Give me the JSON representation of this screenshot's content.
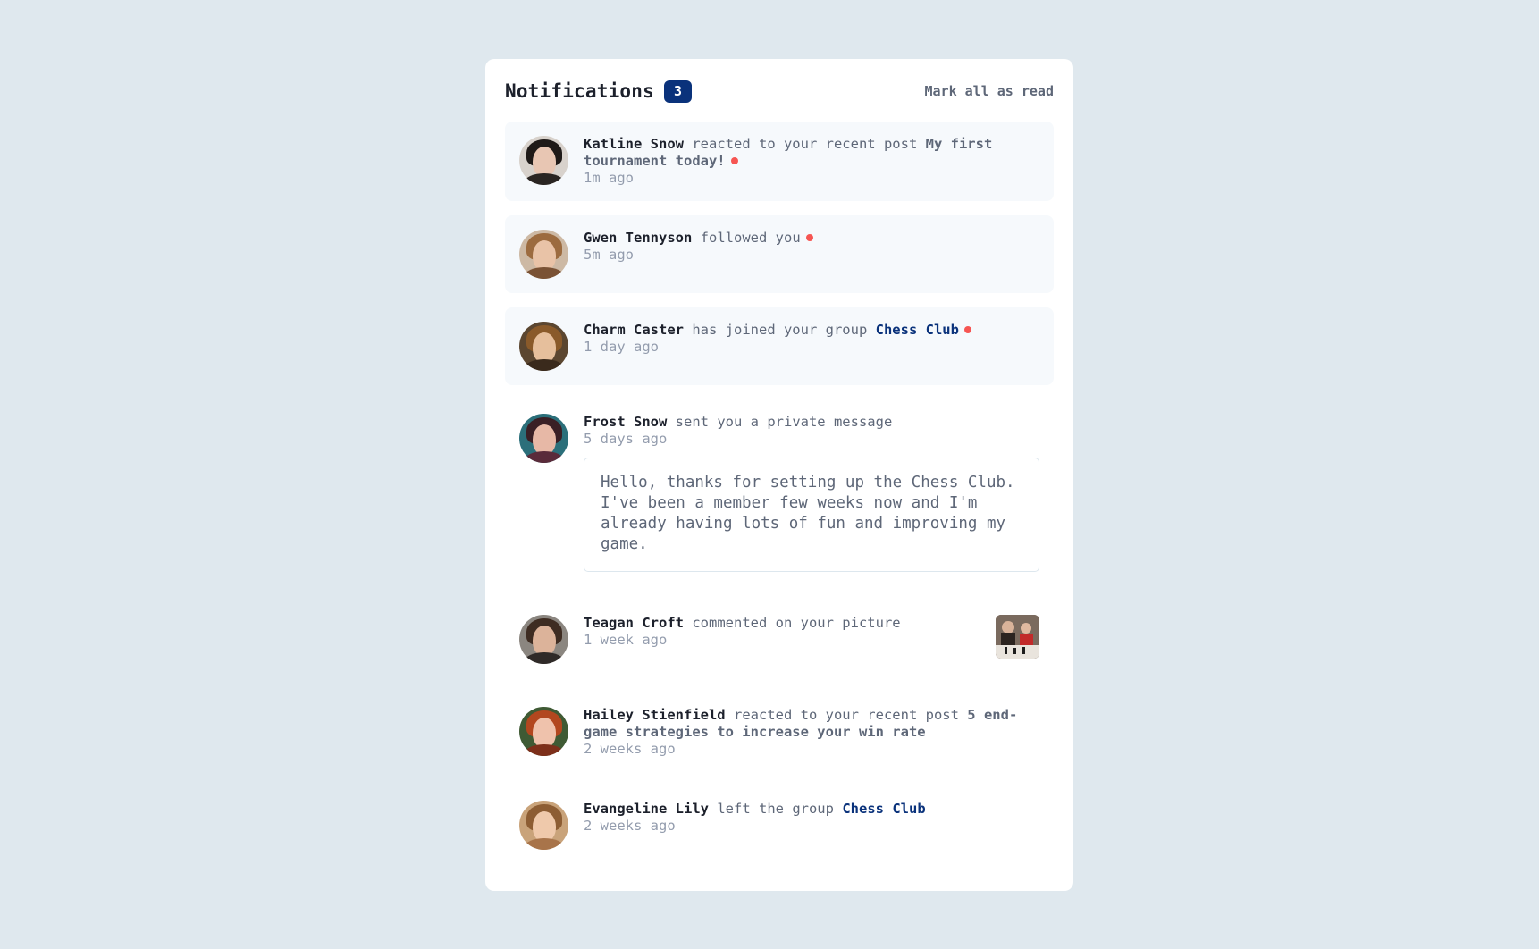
{
  "header": {
    "title": "Notifications",
    "unread_count": "3",
    "mark_all_label": "Mark all as read"
  },
  "notifications": [
    {
      "name": "Katline Snow",
      "action": "reacted to your recent post",
      "post": "My first tournament today!",
      "time": "1m ago",
      "unread": true,
      "avatar_colors": {
        "bg": "#d8d2cc",
        "hair": "#1f1a18",
        "face": "#e8c6b3",
        "body": "#2a2522"
      }
    },
    {
      "name": "Gwen Tennyson",
      "action": "followed you",
      "time": "5m ago",
      "unread": true,
      "avatar_colors": {
        "bg": "#cdb9a4",
        "hair": "#9c6b3f",
        "face": "#e9c3a7",
        "body": "#7a5234"
      }
    },
    {
      "name": "Charm Caster",
      "action": "has joined your group",
      "group": "Chess Club",
      "time": "1 day ago",
      "unread": true,
      "avatar_colors": {
        "bg": "#5b4630",
        "hair": "#8a5a2a",
        "face": "#e6bf9c",
        "body": "#3a2a1c"
      }
    },
    {
      "name": "Frost Snow",
      "action": "sent you a private message",
      "time": "5 days ago",
      "unread": false,
      "message": "Hello, thanks for setting up the Chess Club. I've been a member few weeks now and I'm already having lots of fun and improving my game.",
      "avatar_colors": {
        "bg": "#2b6f7a",
        "hair": "#3a1f25",
        "face": "#e7b8a6",
        "body": "#5a2b3a"
      }
    },
    {
      "name": "Teagan Croft",
      "action": "commented on your picture",
      "time": "1 week ago",
      "unread": false,
      "has_thumbnail": true,
      "avatar_colors": {
        "bg": "#8b8680",
        "hair": "#3e2c22",
        "face": "#dcb39a",
        "body": "#2f2a28"
      }
    },
    {
      "name": "Hailey Stienfield",
      "action": "reacted to your recent post",
      "post": "5 end-game strategies to increase your win rate",
      "time": "2 weeks ago",
      "unread": false,
      "avatar_colors": {
        "bg": "#3f5a34",
        "hair": "#b2471f",
        "face": "#efc2ac",
        "body": "#7d2f1a"
      }
    },
    {
      "name": "Evangeline Lily",
      "action": "left the group",
      "group": "Chess Club",
      "time": "2 weeks ago",
      "unread": false,
      "avatar_colors": {
        "bg": "#c9a37a",
        "hair": "#8d5d33",
        "face": "#efc9ab",
        "body": "#a8744a"
      }
    }
  ]
}
